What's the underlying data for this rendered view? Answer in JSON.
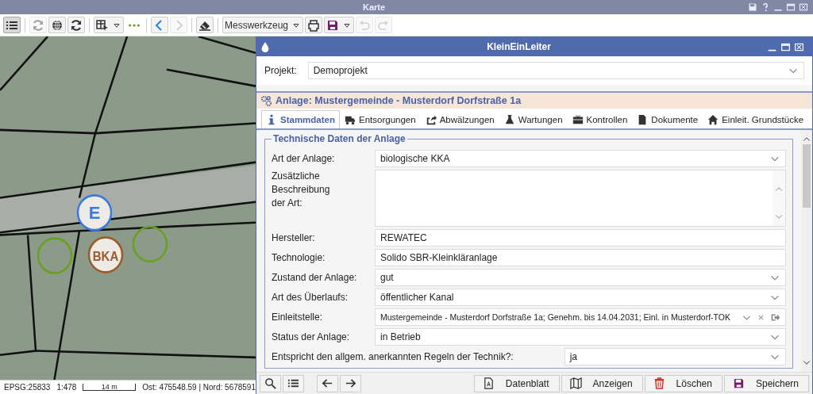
{
  "window": {
    "title": "Karte"
  },
  "toolbar": [
    {
      "kind": "icon",
      "selected": true,
      "disabled": false
    },
    {
      "kind": "icon",
      "selected": false,
      "disabled": true
    },
    {
      "kind": "icon",
      "selected": false,
      "disabled": false
    },
    {
      "kind": "icon",
      "selected": false,
      "disabled": false
    },
    {
      "kind": "split",
      "selected": false,
      "disabled": false
    },
    {
      "kind": "dots",
      "selected": false,
      "disabled": false
    },
    {
      "kind": "icon",
      "selected": false,
      "disabled": false
    },
    {
      "kind": "icon",
      "selected": false,
      "disabled": true
    },
    {
      "kind": "icon",
      "selected": false,
      "disabled": false
    },
    {
      "kind": "dropdown",
      "label": "Messwerkzeug",
      "selected": false,
      "disabled": false
    },
    {
      "kind": "icon",
      "selected": false,
      "disabled": false
    },
    {
      "kind": "split",
      "selected": false,
      "disabled": false
    },
    {
      "kind": "icon",
      "selected": false,
      "disabled": true
    },
    {
      "kind": "icon",
      "selected": false,
      "disabled": true
    }
  ],
  "map": {
    "markers": [
      {
        "kind": "labeled",
        "label": "E",
        "color": "#3a7be0"
      },
      {
        "kind": "circle",
        "color": "#6aa020"
      },
      {
        "kind": "circle",
        "color": "#6aa020"
      },
      {
        "kind": "labeled",
        "label": "BKA",
        "color": "#9a5a2a"
      }
    ]
  },
  "status_bar": {
    "crs": "EPSG:25833",
    "scale": "1:478",
    "scale_bar": "14 m",
    "coordinates": "Ost: 475548.59 | Nord: 5678591"
  },
  "dialog": {
    "title": "KleinEinLeiter",
    "project": {
      "label": "Projekt:",
      "value": "Demoprojekt"
    },
    "record_title": "Anlage: Mustergemeinde - Musterdorf Dorfstraße 1a",
    "tabs": [
      {
        "label": "Stammdaten",
        "selected": true
      },
      {
        "label": "Entsorgungen",
        "selected": false
      },
      {
        "label": "Abwälzungen",
        "selected": false
      },
      {
        "label": "Wartungen",
        "selected": false
      },
      {
        "label": "Kontrollen",
        "selected": false
      },
      {
        "label": "Dokumente",
        "selected": false
      },
      {
        "label": "Einleit. Grundstücke",
        "selected": false
      }
    ],
    "fieldset": {
      "legend": "Technische Daten der Anlage",
      "fields": [
        {
          "kind": "select",
          "label": "Art der Anlage:",
          "value": "biologische KKA"
        },
        {
          "kind": "textarea",
          "label": "Zusätzliche Beschreibung der Art:"
        },
        {
          "kind": "text",
          "label": "Hersteller:",
          "value": "REWATEC"
        },
        {
          "kind": "text",
          "label": "Technologie:",
          "value": "Solido SBR-Kleinkläranlage"
        },
        {
          "kind": "select",
          "label": "Zustand der Anlage:",
          "value": "gut"
        },
        {
          "kind": "select",
          "label": "Art des Überlaufs:",
          "value": "öffentlicher Kanal"
        },
        {
          "kind": "combo",
          "label": "Einleitstelle:",
          "value": "Mustergemeinde - Musterdorf Dorfstraße 1a; Genehm. bis 14.04.2031; Einl. in Musterdorf-TOK"
        },
        {
          "kind": "select",
          "label": "Status der Anlage:",
          "value": "in Betrieb"
        },
        {
          "kind": "select",
          "label": "Entspricht den allgem. anerkannten Regeln der Technik?:",
          "value": "ja"
        }
      ]
    },
    "buttons": [
      {
        "kind": "icon"
      },
      {
        "kind": "icon"
      },
      {
        "kind": "icon"
      },
      {
        "kind": "icon"
      },
      {
        "kind": "text",
        "label": "Datenblatt"
      },
      {
        "kind": "text",
        "label": "Anzeigen"
      },
      {
        "kind": "text",
        "label": "Löschen"
      },
      {
        "kind": "text",
        "label": "Speichern"
      }
    ]
  }
}
